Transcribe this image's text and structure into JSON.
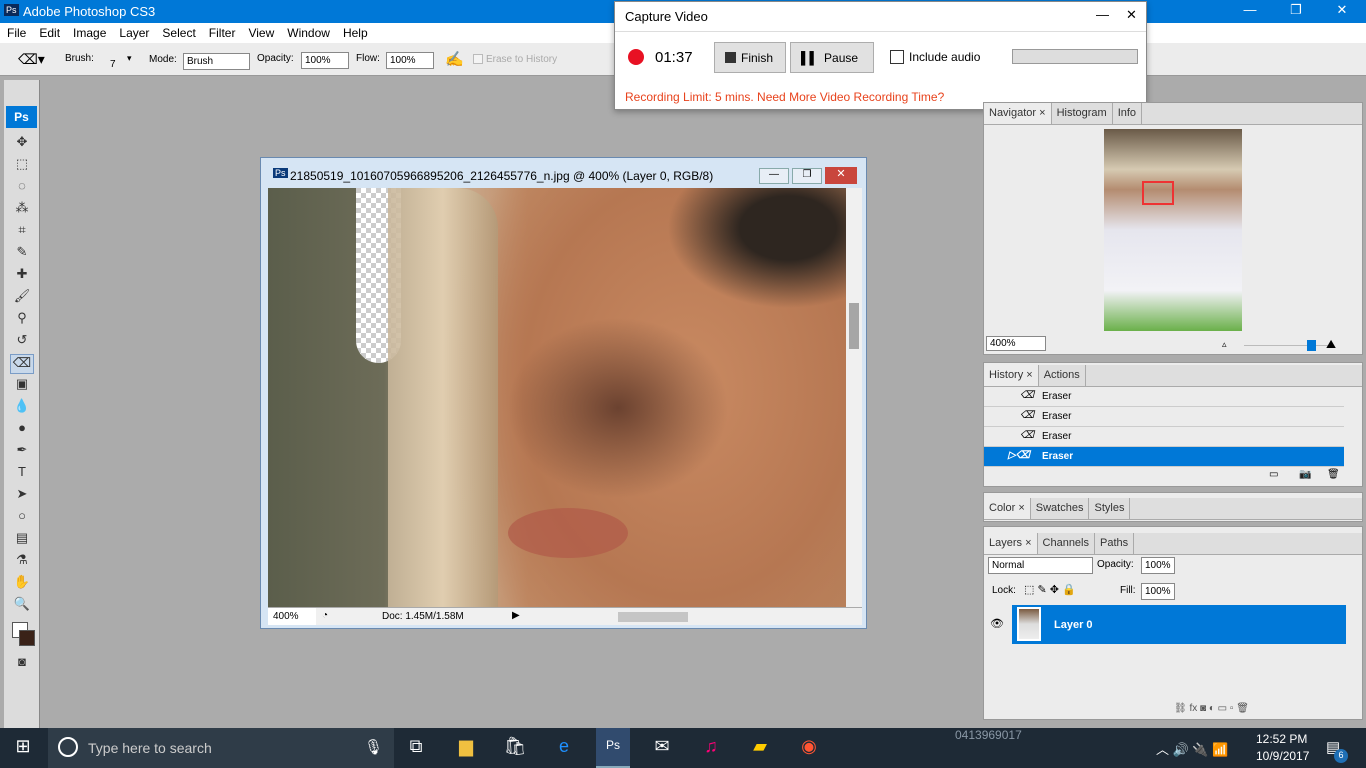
{
  "app": {
    "title": "Adobe Photoshop CS3",
    "logo": "Ps"
  },
  "menu": [
    "File",
    "Edit",
    "Image",
    "Layer",
    "Select",
    "Filter",
    "View",
    "Window",
    "Help"
  ],
  "options": {
    "brush_label": "Brush:",
    "brush_size": "7",
    "mode_label": "Mode:",
    "mode_value": "Brush",
    "opacity_label": "Opacity:",
    "opacity_value": "100%",
    "flow_label": "Flow:",
    "flow_value": "100%",
    "erase_history": "Erase to History"
  },
  "document": {
    "title": "21850519_10160705966895206_2126455776_n.jpg @ 400% (Layer 0, RGB/8)",
    "zoom": "400%",
    "doc_info": "Doc: 1.45M/1.58M"
  },
  "capture": {
    "title": "Capture Video",
    "time": "01:37",
    "finish": "Finish",
    "pause": "Pause",
    "include_audio": "Include audio",
    "limit": "Recording Limit: 5 mins. Need More Video Recording Time?",
    "accent": "#e8431d"
  },
  "navigator": {
    "tabs": [
      "Navigator",
      "Histogram",
      "Info"
    ],
    "zoom": "400%",
    "slider_percent": 75
  },
  "history": {
    "tabs": [
      "History",
      "Actions"
    ],
    "items": [
      "Eraser",
      "Eraser",
      "Eraser",
      "Eraser"
    ],
    "selected": 3
  },
  "color_panel": {
    "tabs": [
      "Color",
      "Swatches",
      "Styles"
    ]
  },
  "layers": {
    "tabs": [
      "Layers",
      "Channels",
      "Paths"
    ],
    "blend": "Normal",
    "opacity_label": "Opacity:",
    "opacity": "100%",
    "lock_label": "Lock:",
    "fill_label": "Fill:",
    "fill": "100%",
    "items": [
      {
        "name": "Layer 0"
      }
    ]
  },
  "taskbar": {
    "search_placeholder": "Type here to search",
    "time": "12:52 PM",
    "date": "10/9/2017",
    "notifications": "6",
    "ghost_text": "0413969017"
  },
  "colors": {
    "selection": "#0078d7"
  }
}
